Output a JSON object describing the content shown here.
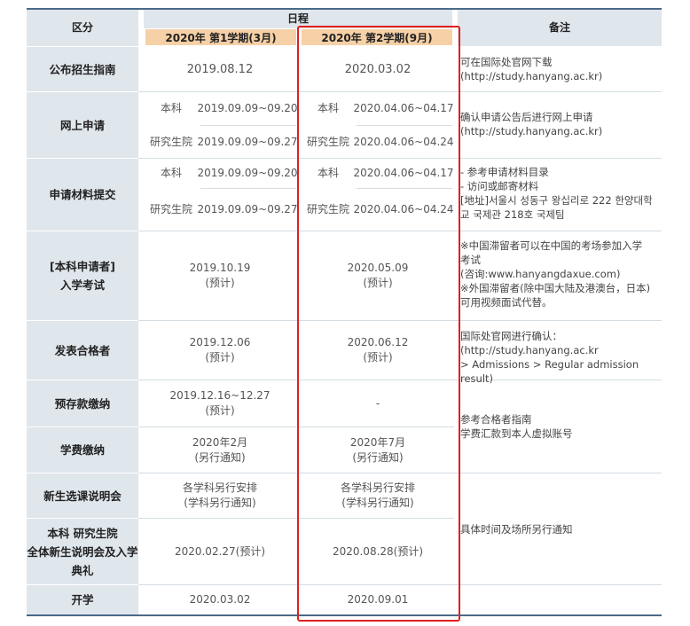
{
  "header": {
    "category": "区分",
    "schedule": "日程",
    "term1": "2020年 第1学期(3月)",
    "term2": "2020年 第2学期(9月)",
    "remarks": "备注"
  },
  "rows": {
    "guide": {
      "label": "公布招生指南",
      "t1": "2019.08.12",
      "t2": "2020.03.02",
      "note": "可在国际处官网下载\n(http://study.hanyang.ac.kr)"
    },
    "apply": {
      "label": "网上申请",
      "t1_ug_type": "本科",
      "t1_ug_date": "2019.09.09~09.20",
      "t1_gr_type": "研究生院",
      "t1_gr_date": "2019.09.09~09.27",
      "t2_ug_type": "本科",
      "t2_ug_date": "2020.04.06~04.17",
      "t2_gr_type": "研究生院",
      "t2_gr_date": "2020.04.06~04.24",
      "note": "确认申请公告后进行网上申请\n(http://study.hanyang.ac.kr)"
    },
    "docs": {
      "label": "申请材料提交",
      "t1_ug_type": "本科",
      "t1_ug_date": "2019.09.09~09.20",
      "t1_gr_type": "研究生院",
      "t1_gr_date": "2019.09.09~09.27",
      "t2_ug_type": "本科",
      "t2_ug_date": "2020.04.06~04.17",
      "t2_gr_type": "研究生院",
      "t2_gr_date": "2020.04.06~04.24",
      "note": "- 参考申请材料目录\n- 访问或邮寄材料\n[地址]서울시 성동구 왕십리로 222 한양대학\n교 국제관 218호 국제팀"
    },
    "exam": {
      "label": "[本科申请者]\n入学考试",
      "t1": "2019.10.19\n(预计)",
      "t2": "2020.05.09\n(预计)",
      "note": "※中国滞留者可以在中国的考场参加入学\n   考试\n   (咨询:www.hanyangdaxue.com)\n※外国滞留者(除中国大陆及港澳台，日本)\n   可用视频面试代替。"
    },
    "result": {
      "label": "发表合格者",
      "t1": "2019.12.06\n(预计)",
      "t2": "2020.06.12\n(预计)",
      "note": "国际处官网进行确认：\n(http://study.hanyang.ac.kr\n> Admissions > Regular admission result)"
    },
    "deposit": {
      "label": "预存款缴纳",
      "t1": "2019.12.16~12.27\n(预计)",
      "t2": "-"
    },
    "tuition": {
      "label": "学费缴纳",
      "t1": "2020年2月\n(另行通知)",
      "t2": "2020年7月\n(另行通知)"
    },
    "pay_note": "参考合格者指南\n学费汇款到本人虚拟账号",
    "course": {
      "label": "新生选课说明会",
      "t1": "各学科另行安排\n(学科另行通知)",
      "t2": "各学科另行安排\n(学科另行通知)"
    },
    "orientation": {
      "label": "本科 研究生院\n全体新生说明会及入学\n典礼",
      "t1": "2020.02.27(预计)",
      "t2": "2020.08.28(预计)"
    },
    "event_note": "具体时间及场所另行通知",
    "start": {
      "label": "开学",
      "t1": "2020.03.02",
      "t2": "2020.09.01"
    }
  },
  "colors": {
    "header_bg": "#dfe6ec",
    "term_bg": "#f6d0a6",
    "highlight_border": "#e02020",
    "rule": "#4a6a88"
  }
}
